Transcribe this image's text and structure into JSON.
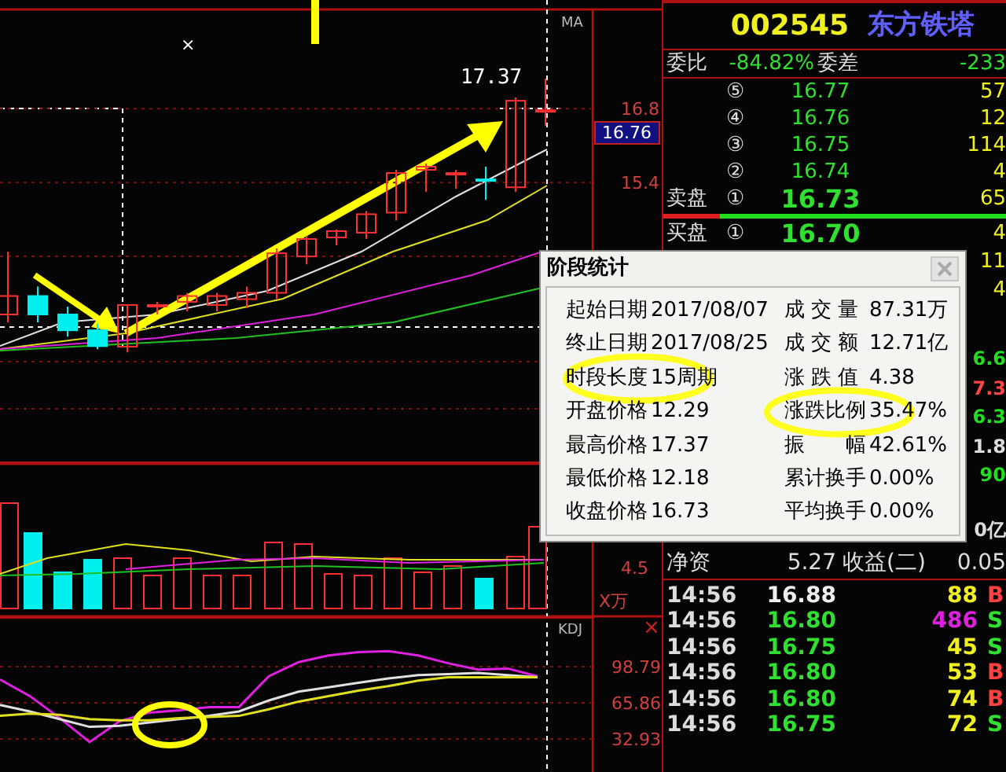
{
  "chart": {
    "cursor_mark": "×",
    "ma_label": "MA",
    "high_marker": "17.37",
    "current_price": "16.76",
    "chart_data": {
      "type": "candlestick",
      "ylim": [
        10.07,
        18.68
      ],
      "yticks": [
        15.4,
        16.8
      ],
      "grid": true,
      "ohlc": [
        [
          12.9,
          14.09,
          12.75,
          13.25
        ],
        [
          13.25,
          13.43,
          12.75,
          12.9
        ],
        [
          12.9,
          13.05,
          12.48,
          12.6
        ],
        [
          12.6,
          12.72,
          12.24,
          12.3
        ],
        [
          12.29,
          13.08,
          12.18,
          13.08
        ],
        [
          13.05,
          13.14,
          12.9,
          13.08
        ],
        [
          13.14,
          13.31,
          12.96,
          13.25
        ],
        [
          13.08,
          13.31,
          12.96,
          13.25
        ],
        [
          13.19,
          13.43,
          13.02,
          13.31
        ],
        [
          13.31,
          14.15,
          13.19,
          14.06
        ],
        [
          14.0,
          14.39,
          13.85,
          14.33
        ],
        [
          14.36,
          14.51,
          14.21,
          14.48
        ],
        [
          14.45,
          14.86,
          14.33,
          14.8
        ],
        [
          14.83,
          15.64,
          14.68,
          15.58
        ],
        [
          15.64,
          15.76,
          15.22,
          15.7
        ],
        [
          15.55,
          15.64,
          15.28,
          15.58
        ],
        [
          15.46,
          15.7,
          15.07,
          15.43
        ],
        [
          15.31,
          17.01,
          15.22,
          16.95
        ],
        [
          16.74,
          17.37,
          16.47,
          16.77
        ]
      ]
    }
  },
  "volume_panel": {
    "axis_label": "4.5",
    "unit": "X万"
  },
  "kdj_panel": {
    "title": "KDJ",
    "close_mark": "×",
    "chart_data": {
      "type": "line",
      "ylim": [
        2.87,
        144.6
      ],
      "yticks": [
        98.79,
        65.86,
        32.93
      ],
      "grid": true,
      "series": [
        {
          "color": "#e020e0",
          "values": [
            87,
            72,
            52,
            30,
            49,
            57,
            59,
            62,
            62,
            90,
            103,
            109,
            112,
            113,
            109,
            102,
            96,
            97,
            90
          ]
        },
        {
          "color": "#e0e0e0",
          "values": [
            64,
            58,
            51,
            44,
            45,
            48,
            51,
            54,
            58,
            68,
            76,
            80,
            84,
            88,
            91,
            92,
            93,
            91,
            89
          ]
        },
        {
          "color": "#e0e020",
          "values": [
            54,
            56,
            55,
            51,
            50,
            50,
            52,
            53,
            54,
            60,
            67,
            72,
            77,
            81,
            86,
            89,
            89,
            89,
            89
          ]
        }
      ]
    }
  },
  "quote": {
    "code": "002545",
    "name": "东方铁塔",
    "ratio_label": "委比",
    "ratio_value": "-84.82%",
    "diff_label": "委差",
    "diff_value": "-233",
    "asks": [
      {
        "index": "⑤",
        "price": "16.77",
        "volume": "57"
      },
      {
        "index": "④",
        "price": "16.76",
        "volume": "12"
      },
      {
        "index": "③",
        "price": "16.75",
        "volume": "114"
      },
      {
        "index": "②",
        "price": "16.74",
        "volume": "4"
      },
      {
        "side_label": "卖盘",
        "index": "①",
        "price": "16.73",
        "volume": "65"
      }
    ],
    "bids": [
      {
        "side_label": "买盘",
        "index": "①",
        "price": "16.70",
        "volume": "4"
      },
      {
        "volume": "11"
      },
      {
        "volume": "4"
      }
    ],
    "info_fragments": [
      {
        "text": "6.6",
        "color": "#22dd22"
      },
      {
        "text": "7.3",
        "color": "#ff4444"
      },
      {
        "text": "6.3",
        "color": "#22dd22"
      },
      {
        "text": "1.8",
        "color": "#dddddd"
      },
      {
        "text": "90",
        "color": "#22dd22"
      },
      {
        "text": "0亿",
        "color": "#dddddd"
      }
    ],
    "net_assets_label": "净资",
    "net_assets_value": "5.27",
    "eps_label": "收益(二)",
    "eps_value": "0.05"
  },
  "ticks": [
    {
      "time": "14:56",
      "price": "16.88",
      "color": "#eeeeee",
      "volume": "88",
      "large": false,
      "side": "B",
      "buy": true
    },
    {
      "time": "14:56",
      "price": "16.80",
      "color": "#30e030",
      "volume": "486",
      "large": true,
      "side": "S",
      "buy": false
    },
    {
      "time": "14:56",
      "price": "16.75",
      "color": "#30e030",
      "volume": "45",
      "large": false,
      "side": "S",
      "buy": false
    },
    {
      "time": "14:56",
      "price": "16.80",
      "color": "#30e030",
      "volume": "53",
      "large": false,
      "side": "B",
      "buy": true
    },
    {
      "time": "14:56",
      "price": "16.80",
      "color": "#30e030",
      "volume": "74",
      "large": false,
      "side": "B",
      "buy": true
    },
    {
      "time": "14:56",
      "price": "16.75",
      "color": "#30e030",
      "volume": "72",
      "large": false,
      "side": "S",
      "buy": false
    }
  ],
  "dialog": {
    "title": "阶段统计",
    "left": [
      {
        "label": "起始日期",
        "value": "2017/08/07",
        "highlighted": false
      },
      {
        "label": "终止日期",
        "value": "2017/08/25",
        "highlighted": false
      },
      {
        "label": "时段长度",
        "value": "15周期",
        "highlighted": true
      },
      {
        "label": "开盘价格",
        "value": "12.29",
        "highlighted": false
      },
      {
        "label": "最高价格",
        "value": "17.37",
        "highlighted": false
      },
      {
        "label": "最低价格",
        "value": "12.18",
        "highlighted": false
      },
      {
        "label": "收盘价格",
        "value": "16.73",
        "highlighted": false
      }
    ],
    "right": [
      {
        "label": "成 交 量",
        "value": "87.31万",
        "highlighted": false
      },
      {
        "label": "成 交 额",
        "value": "12.71亿",
        "highlighted": false
      },
      {
        "label": "涨 跌 值",
        "value": "4.38",
        "highlighted": false
      },
      {
        "label": "涨跌比例",
        "value": "35.47%",
        "highlighted": true
      },
      {
        "label": "振　　幅",
        "value": "42.61%",
        "highlighted": false
      },
      {
        "label": "累计换手",
        "value": "0.00%",
        "highlighted": false
      },
      {
        "label": "平均换手",
        "value": "0.00%",
        "highlighted": false
      }
    ]
  }
}
